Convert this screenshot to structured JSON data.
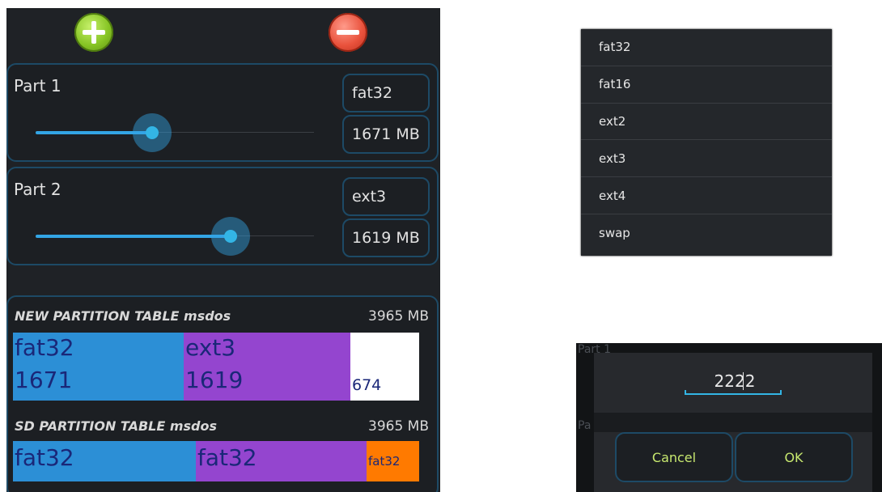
{
  "partitions": [
    {
      "label": "Part 1",
      "fs_type": "fat32",
      "size": "1671 MB",
      "slider_fraction": 0.42
    },
    {
      "label": "Part 2",
      "fs_type": "ext3",
      "size": "1619 MB",
      "slider_fraction": 0.7
    }
  ],
  "new_table": {
    "title": "NEW PARTITION TABLE msdos",
    "total": "3965 MB",
    "segments": [
      {
        "type": "fat32",
        "size": "1671",
        "color": "#2c8fd6"
      },
      {
        "type": "ext3",
        "size": "1619",
        "color": "#9445cf"
      },
      {
        "type": "",
        "size": "674",
        "color": "#ffffff"
      }
    ]
  },
  "sd_table": {
    "title": "SD PARTITION TABLE msdos",
    "total": "3965 MB",
    "segments": [
      {
        "type": "fat32",
        "color": "#2c8fd6"
      },
      {
        "type": "fat32",
        "color": "#9445cf"
      },
      {
        "type": "fat32",
        "color": "#ff7a00"
      }
    ]
  },
  "fs_options": [
    "fat32",
    "fat16",
    "ext2",
    "ext3",
    "ext4",
    "swap"
  ],
  "dialog": {
    "value": "2222",
    "cancel_label": "Cancel",
    "ok_label": "OK",
    "bg_text_1": "Part 1",
    "bg_text_2": "Pa"
  },
  "icons": {
    "add": "plus-circle-icon",
    "remove": "minus-circle-icon"
  },
  "colors": {
    "accent": "#33b5e5",
    "border": "#1d4a66",
    "button_text": "#c7e86f"
  }
}
